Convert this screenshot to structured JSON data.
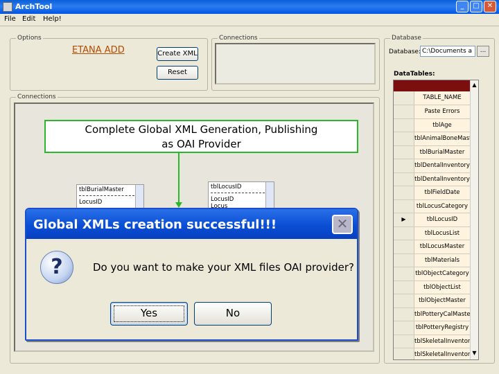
{
  "window": {
    "title": "ArchTool",
    "min": "_",
    "max": "□",
    "close": "✕"
  },
  "menu": [
    "File",
    "Edit",
    "Help!"
  ],
  "options": {
    "label": "Options",
    "etana_link": "ETANA ADD",
    "create_xml": "Create XML",
    "reset": "Reset"
  },
  "connections_top": {
    "label": "Connections"
  },
  "database": {
    "group_label": "Database",
    "field_label": "Database:",
    "value": "C:\\Documents a",
    "browse": "...",
    "datatables_label": "DataTables:"
  },
  "tables": {
    "header": "TABLE_NAME",
    "selected_marker": "▶",
    "selected_index": 8,
    "rows": [
      "Paste Errors",
      "tblAge",
      "tblAnimalBoneMast",
      "tblBurialMaster",
      "tblDentalInventory",
      "tblDentalInventory",
      "tblFieldDate",
      "tblLocusCategory",
      "tblLocusID",
      "tblLocusList",
      "tblLocusMaster",
      "tblMaterials",
      "tblObjectCategory",
      "tblObjectList",
      "tblObjectMaster",
      "tblPotteryCalMaste",
      "tblPotteryRegistry",
      "tblSkeletalInventor",
      "tblSkeletalInventor"
    ]
  },
  "connections_main": {
    "label": "Connections",
    "list1": {
      "title": "tblBurialMaster",
      "items": [
        "LocusID"
      ]
    },
    "list2": {
      "title": "tblLocusID",
      "items": [
        "LocusID",
        "Locus"
      ]
    }
  },
  "annotation": {
    "line1": "Complete Global XML Generation, Publishing",
    "line2": "as OAI Provider"
  },
  "dialog": {
    "title": "Global XMLs creation successful!!!",
    "close": "✕",
    "icon": "?",
    "message": "Do you want to make your XML files OAI provider?",
    "yes": "Yes",
    "no": "No"
  },
  "colors": {
    "titlebar": "#0054e3",
    "annotation_border": "#2ab82a",
    "grid_header": "#7b0f0f"
  }
}
